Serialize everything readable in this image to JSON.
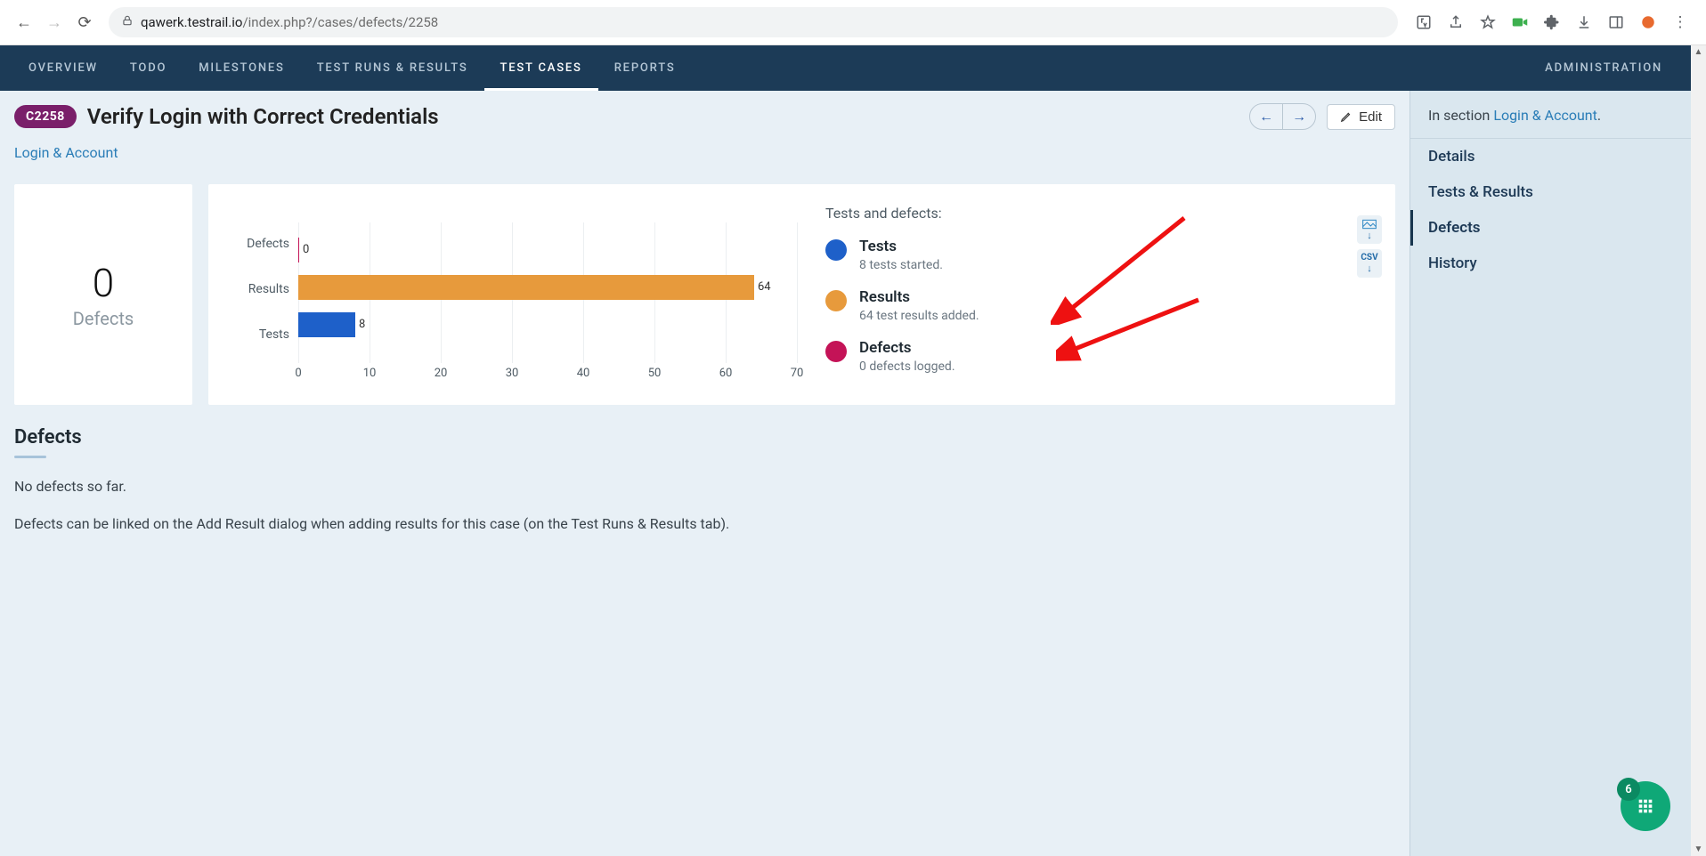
{
  "browser": {
    "url_host": "qawerk.testrail.io",
    "url_path": "/index.php?/cases/defects/2258"
  },
  "top_nav": {
    "items": [
      "OVERVIEW",
      "TODO",
      "MILESTONES",
      "TEST RUNS & RESULTS",
      "TEST CASES",
      "REPORTS"
    ],
    "admin": "ADMINISTRATION",
    "active_index": 4
  },
  "header": {
    "case_id": "C2258",
    "title": "Verify Login with Correct Credentials",
    "edit_label": "Edit"
  },
  "breadcrumb": {
    "section_link": "Login & Account"
  },
  "summary_card": {
    "count": "0",
    "label": "Defects"
  },
  "chart_legend": {
    "title": "Tests and defects:",
    "items": [
      {
        "title": "Tests",
        "sub": "8 tests started.",
        "color": "#1e60c9"
      },
      {
        "title": "Results",
        "sub": "64 test results added.",
        "color": "#e79a3c"
      },
      {
        "title": "Defects",
        "sub": "0 defects logged.",
        "color": "#c41357"
      }
    ]
  },
  "chart_data": {
    "type": "bar",
    "orientation": "horizontal",
    "categories": [
      "Defects",
      "Results",
      "Tests"
    ],
    "values": [
      0,
      64,
      8
    ],
    "colors": [
      "#c41357",
      "#e79a3c",
      "#1e60c9"
    ],
    "xlim": [
      0,
      70
    ],
    "xticks": [
      0,
      10,
      20,
      30,
      40,
      50,
      60,
      70
    ],
    "title": "",
    "xlabel": "",
    "ylabel": ""
  },
  "defects_section": {
    "heading": "Defects",
    "empty_msg": "No defects so far.",
    "help_msg": "Defects can be linked on the Add Result dialog when adding results for this case (on the Test Runs & Results tab)."
  },
  "sidebar": {
    "in_section_label": "In section ",
    "in_section_link": "Login & Account",
    "items": [
      "Details",
      "Tests & Results",
      "Defects",
      "History"
    ],
    "active_index": 2
  },
  "download_buttons": {
    "image_label": "IMG",
    "csv_label": "CSV"
  },
  "fab": {
    "badge": "6"
  }
}
